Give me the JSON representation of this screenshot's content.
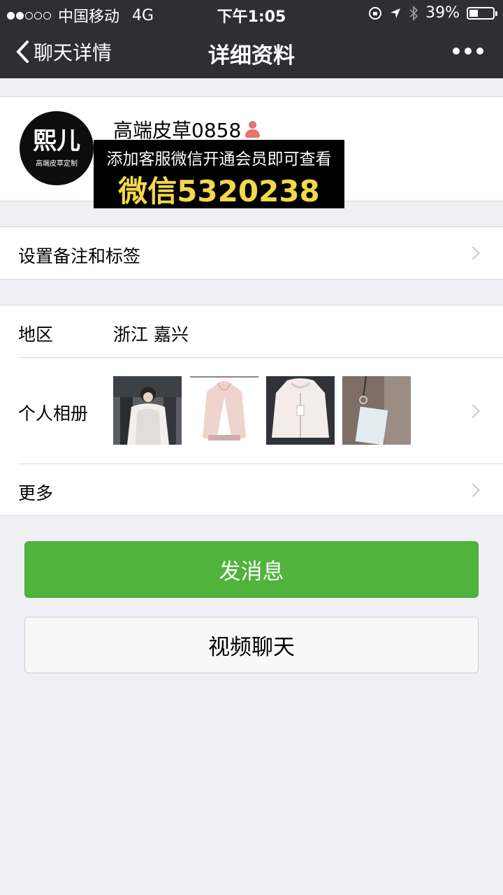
{
  "status": {
    "carrier": "中国移动",
    "network": "4G",
    "time": "下午1:05",
    "battery": "39%",
    "battery_level": 0.39
  },
  "nav": {
    "back_label": "聊天详情",
    "title": "详细资料"
  },
  "profile": {
    "name": "高端皮草0858",
    "avatar_logo": "熙儿",
    "avatar_sub": "高端皮草定制",
    "overlay_line1": "添加客服微信开通会员即可查看",
    "overlay_line2": "微信5320238"
  },
  "rows": {
    "remark": "设置备注和标签",
    "region_label": "地区",
    "region_value": "浙江 嘉兴",
    "album_label": "个人相册",
    "more": "更多"
  },
  "buttons": {
    "message": "发消息",
    "video": "视频聊天"
  },
  "icons": {
    "back": "chevron-left-icon",
    "more": "more-dots-icon",
    "person": "female-person-icon"
  },
  "colors": {
    "primary_green": "#4fb33c",
    "overlay_text": "#f3d84a",
    "navbar": "#2e2e33"
  }
}
